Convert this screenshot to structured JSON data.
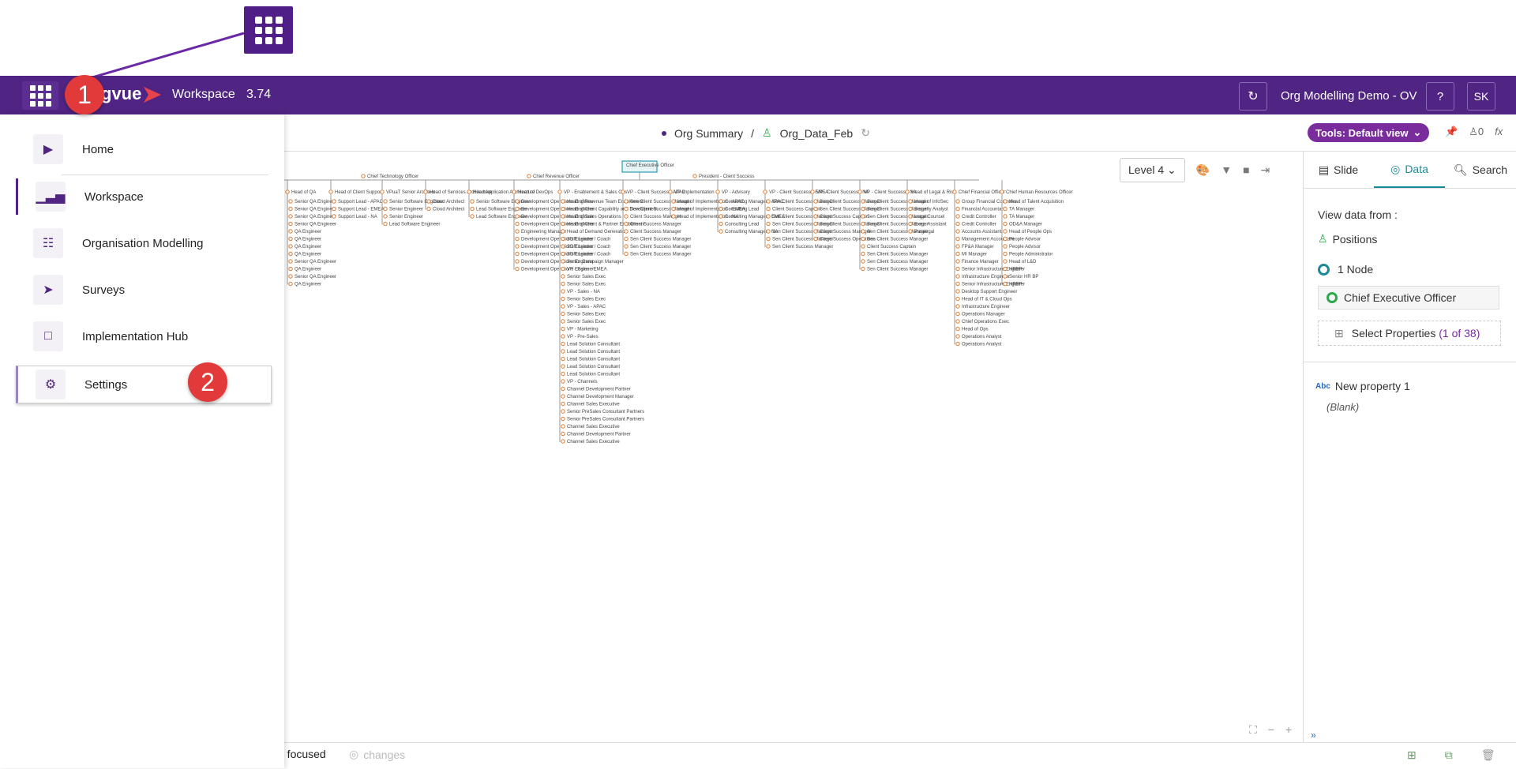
{
  "float_launcher": {
    "icon": "apps-grid-icon"
  },
  "header": {
    "brand": "gvue",
    "title": "Workspace",
    "version": "3.74",
    "project": "Org Modelling Demo - OV",
    "help": "?",
    "avatar": "SK"
  },
  "annotations": {
    "step1": "1",
    "step2": "2"
  },
  "subheader": {
    "crumb1": "Org Summary",
    "separator": "/",
    "crumb2": "Org_Data_Feb",
    "tools": "Tools: Default view",
    "flag_count": "0",
    "fx": "fx"
  },
  "canvas": {
    "level": "Level 4",
    "root_label": "Chief Executive Officer"
  },
  "right_panel": {
    "tabs": [
      "Slide",
      "Data",
      "Search"
    ],
    "view_label": "View data from :",
    "positions": "Positions",
    "node_count": "1 Node",
    "selected_node": "Chief Executive Officer",
    "select_props": "Select Properties",
    "props_count": "(1 of 38)",
    "new_prop": "New property 1",
    "blank": "(Blank)"
  },
  "bottom": {
    "focused": "0 focused",
    "changes": "changes"
  },
  "menu": {
    "items": [
      {
        "label": "Home",
        "icon": "home-play-icon"
      },
      {
        "label": "Workspace",
        "icon": "bar-chart-icon"
      },
      {
        "label": "Organisation Modelling",
        "icon": "org-chart-icon"
      },
      {
        "label": "Surveys",
        "icon": "paper-plane-icon"
      },
      {
        "label": "Implementation Hub",
        "icon": "square-icon"
      },
      {
        "label": "Settings",
        "icon": "gear-icon"
      }
    ]
  },
  "org_columns": [
    {
      "head": "Head of QA",
      "items": [
        "Senior QA Engineer",
        "Senior QA Engineer",
        "Senior QA Engineer",
        "Senior QA Engineer",
        "QA Engineer",
        "QA Engineer",
        "QA Engineer",
        "QA Engineer",
        "Senior QA Engineer",
        "QA Engineer",
        "Senior QA Engineer",
        "QA Engineer"
      ]
    },
    {
      "head": "Head of Client Support",
      "items": [
        "Support Lead - APAC",
        "Support Lead - EMEA",
        "Support Lead - NA"
      ]
    },
    {
      "head": "VPuaT Senior Architect",
      "items": [
        "Senior Software Engineer",
        "Senior Engineer",
        "Senior Engineer",
        "Lead Software Engineer"
      ]
    },
    {
      "head": "Head of Services Architecture",
      "items": [
        "Cloud Architect",
        "Cloud Architect"
      ]
    },
    {
      "head": "Head Application Architecture",
      "items": [
        "Senior Software Engineer",
        "Lead Software Engineer",
        "Lead Software Engineer"
      ]
    },
    {
      "head": "Head of DevOps",
      "items": [
        "Development Operations Engineer",
        "Development Operations Engineer",
        "Development Operations Engineer",
        "Development Operations Engineer",
        "Engineering Manager",
        "Development Operations Engineer",
        "Development Operations Engineer",
        "Development Operations Engineer",
        "Development Operations Engineer",
        "Development Operations Engineer"
      ]
    },
    {
      "head": "VP - Enablement & Sales Ops",
      "items": [
        "Head of Revenue Team Enablement",
        "Head of Client Capability and Development",
        "Head of Sales Operations",
        "Head of Client & Partner Enablement",
        "Head of Demand Generation",
        "SDR Leader / Coach",
        "SDR Leader / Coach",
        "SDR Leader / Coach",
        "Senior Campaign Manager",
        "VP - Sales - EMEA",
        "Senior Sales Exec",
        "Senior Sales Exec",
        "VP - Sales - NA",
        "Senior Sales Exec",
        "VP - Sales - APAC",
        "Senior Sales Exec",
        "Senior Sales Exec",
        "VP - Marketing",
        "VP - Pre-Sales",
        "Lead Solution Consultant",
        "Lead Solution Consultant",
        "Lead Solution Consultant",
        "Lead Solution Consultant",
        "Lead Solution Consultant",
        "VP - Channels",
        "Channel Development Partner",
        "Channel Development Manager",
        "Channel Sales Executive",
        "Senior PreSales Consultant Partners",
        "Senior PreSales Consultant Partners",
        "Channel Sales Executive",
        "Channel Development Partner",
        "Channel Sales Executive"
      ]
    },
    {
      "head": "VP - Client Success - APAC",
      "items": [
        "Sen Client Success Manager",
        "Sen Client Success Manager",
        "Client Success Manager",
        "Client Success Manager",
        "Client Success Manager",
        "Sen Client Success Manager",
        "Sen Client Success Manager",
        "Sen Client Success Manager"
      ]
    },
    {
      "head": "VP Implementation",
      "items": [
        "Head of Implementation - APAC",
        "Head of Implementation - EMEA",
        "Head of Implementation - NA"
      ]
    },
    {
      "head": "VP - Advisory",
      "items": [
        "Consulting Manager - APAC",
        "Consulting Lead",
        "Consulting Manager - EMEA",
        "Consulting Lead",
        "Consulting Manager - NA"
      ]
    },
    {
      "head": "VP - Client Success - EMEA",
      "items": [
        "Sen Client Success Manager",
        "Client Success Captain",
        "Sen Client Success Manager",
        "Sen Client Success Manager",
        "Sen Client Success Manager",
        "Sen Client Success Manager",
        "Sen Client Success Manager"
      ]
    },
    {
      "head": "VP - Client Success - NA",
      "items": [
        "Sen Client Success Manager",
        "Sen Client Success Manager",
        "Client Success Captain",
        "Sen Client Success Manager",
        "Client Success Manager",
        "Client Success Operations"
      ]
    },
    {
      "head": "VP - Client Success - NA",
      "items": [
        "Sen Client Success Manager",
        "Sen Client Success Manager",
        "Sen Client Success Manager",
        "Sen Client Success Manager",
        "Sen Client Success Manager",
        "Sen Client Success Manager",
        "Client Success Captain",
        "Sen Client Success Manager",
        "Sen Client Success Manager",
        "Sen Client Success Manager"
      ]
    },
    {
      "head": "Head of Legal & Risk",
      "items": [
        "Head of InfoSec",
        "Security Analyst",
        "Legal Counsel",
        "Exec. Assistant",
        "Paralegal"
      ]
    },
    {
      "head": "Chief Financial Officer",
      "items": [
        "Group Financial Controller",
        "Financial Accountant",
        "Credit Controller",
        "Credit Controller",
        "Accounts Assistant",
        "Management Accountant",
        "FP&A Manager",
        "MI Manager",
        "Finance Manager",
        "Senior Infrastructure Engineer",
        "Infrastructure Engineer",
        "Senior Infrastructure Engineer",
        "Desktop Support Engineer",
        "Head of IT & Cloud Ops",
        "Infrastructure Engineer",
        "Operations Manager",
        "Chief Operations Exec",
        "Head of Ops",
        "Operations Analyst",
        "Operations Analyst"
      ]
    },
    {
      "head": "Chief Human Resources Officer",
      "items": [
        "Head of Talent Acquisition",
        "TA Manager",
        "TA Manager",
        "OD&A Manager",
        "Head of People Ops",
        "People Advisor",
        "People Advisor",
        "People Administrator",
        "Head of L&D",
        "HRBP",
        "Senior HR BP",
        "HRBP"
      ]
    }
  ],
  "org_top": [
    {
      "label": "Chief Technology Officer"
    },
    {
      "label": "Chief Revenue Officer"
    },
    {
      "label": "President - Client Success"
    }
  ]
}
